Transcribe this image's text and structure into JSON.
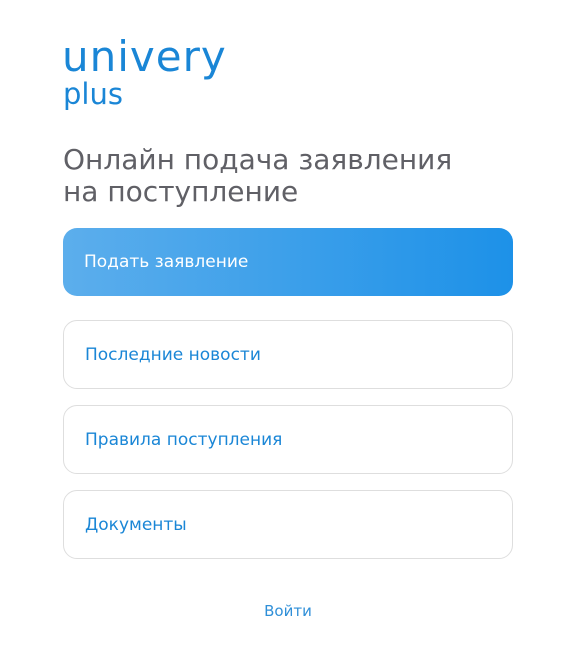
{
  "logo": {
    "main": "univery",
    "sub": "plus"
  },
  "headline": {
    "line1": "Онлайн подача заявления",
    "line2": "на поступление"
  },
  "menu": {
    "items": [
      {
        "label": "Подать заявление"
      },
      {
        "label": "Последние новости"
      },
      {
        "label": "Правила поступления"
      },
      {
        "label": "Документы"
      }
    ]
  },
  "login": {
    "label": "Войти"
  },
  "colors": {
    "brand": "#1a86d6",
    "primary_gradient_start": "#5caeec",
    "primary_gradient_end": "#1d91e8",
    "headline_text": "#606066",
    "card_border": "#dedede"
  }
}
